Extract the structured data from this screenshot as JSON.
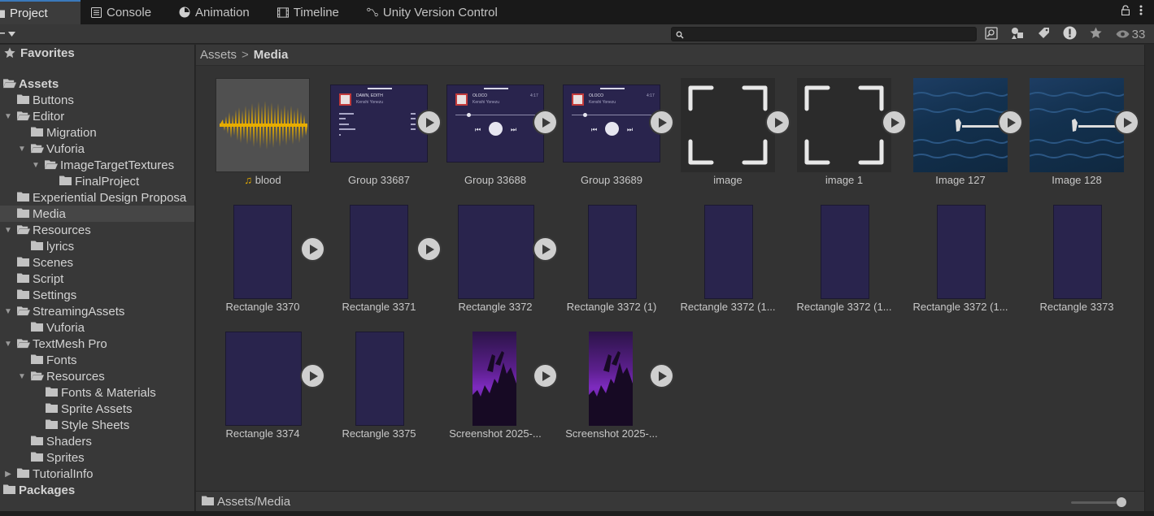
{
  "tabs": [
    {
      "label": "Project",
      "icon": "folder-icon",
      "active": true
    },
    {
      "label": "Console",
      "icon": "console-icon",
      "active": false
    },
    {
      "label": "Animation",
      "icon": "animation-icon",
      "active": false
    },
    {
      "label": "Timeline",
      "icon": "timeline-icon",
      "active": false
    },
    {
      "label": "Unity Version Control",
      "icon": "version-control-icon",
      "active": false
    }
  ],
  "toolbar": {
    "search_placeholder": "",
    "hidden_count": "33"
  },
  "sidebar": {
    "favorites_label": "Favorites",
    "assets_label": "Assets",
    "packages_label": "Packages",
    "items": [
      {
        "label": "Buttons"
      },
      {
        "label": "Editor"
      },
      {
        "label": "Migration"
      },
      {
        "label": "Vuforia"
      },
      {
        "label": "ImageTargetTextures"
      },
      {
        "label": "FinalProject"
      },
      {
        "label": "Experiential Design Proposa"
      },
      {
        "label": "Media"
      },
      {
        "label": "Resources"
      },
      {
        "label": "lyrics"
      },
      {
        "label": "Scenes"
      },
      {
        "label": "Script"
      },
      {
        "label": "Settings"
      },
      {
        "label": "StreamingAssets"
      },
      {
        "label": "Vuforia"
      },
      {
        "label": "TextMesh Pro"
      },
      {
        "label": "Fonts"
      },
      {
        "label": "Resources"
      },
      {
        "label": "Fonts & Materials"
      },
      {
        "label": "Sprite Assets"
      },
      {
        "label": "Style Sheets"
      },
      {
        "label": "Shaders"
      },
      {
        "label": "Sprites"
      },
      {
        "label": "TutorialInfo"
      }
    ]
  },
  "breadcrumb": {
    "root": "Assets",
    "current": "Media"
  },
  "assets": [
    {
      "name": "blood",
      "kind": "audio"
    },
    {
      "name": "Group 33687",
      "kind": "sprite"
    },
    {
      "name": "Group 33688",
      "kind": "sprite"
    },
    {
      "name": "Group 33689",
      "kind": "sprite"
    },
    {
      "name": "image",
      "kind": "sprite"
    },
    {
      "name": "image 1",
      "kind": "sprite"
    },
    {
      "name": "Image 127",
      "kind": "sprite"
    },
    {
      "name": "Image 128",
      "kind": "sprite"
    },
    {
      "name": "Rectangle 3370",
      "kind": "sprite"
    },
    {
      "name": "Rectangle 3371",
      "kind": "sprite"
    },
    {
      "name": "Rectangle 3372",
      "kind": "sprite"
    },
    {
      "name": "Rectangle 3372 (1)",
      "kind": "sprite"
    },
    {
      "name": "Rectangle 3372 (1...",
      "kind": "sprite"
    },
    {
      "name": "Rectangle 3372 (1...",
      "kind": "sprite"
    },
    {
      "name": "Rectangle 3372 (1...",
      "kind": "sprite"
    },
    {
      "name": "Rectangle 3373",
      "kind": "sprite"
    },
    {
      "name": "Rectangle 3374",
      "kind": "sprite"
    },
    {
      "name": "Rectangle 3375",
      "kind": "sprite"
    },
    {
      "name": "Screenshot 2025-...",
      "kind": "sprite"
    },
    {
      "name": "Screenshot 2025-...",
      "kind": "sprite"
    }
  ],
  "mock_texts": {
    "song1_title": "DAWN, EDITH",
    "song_artist": "Kenshi Yonezu",
    "song2_title": "OLOCO",
    "song2_time": "4:17"
  },
  "statusbar": {
    "path": "Assets/Media"
  },
  "colors": {
    "accent": "#3a79bb",
    "panel": "#383838",
    "grid_bg": "#333333",
    "mock_purple": "#29244d",
    "audio_wave": "#e6ac00"
  }
}
